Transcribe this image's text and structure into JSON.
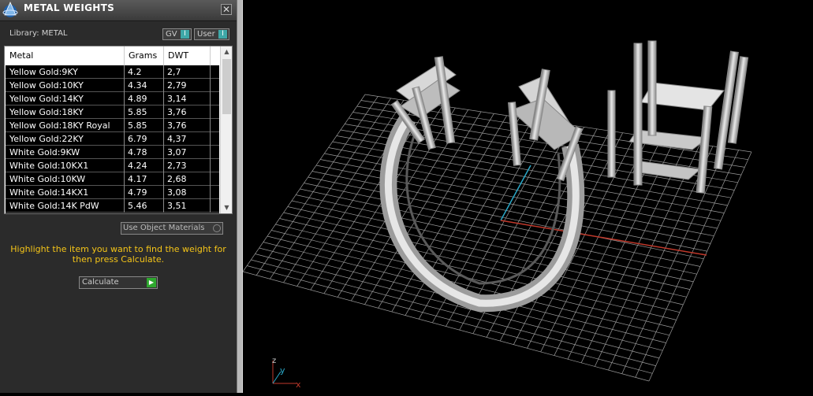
{
  "panel": {
    "title": "METAL WEIGHTS",
    "close_glyph": "✕",
    "library_label": "Library: METAL",
    "toggles": [
      {
        "label": "GV",
        "state": "I"
      },
      {
        "label": "User",
        "state": "I"
      }
    ],
    "table": {
      "columns": [
        "Metal",
        "Grams",
        "DWT"
      ],
      "rows": [
        {
          "metal": "Yellow Gold:9KY",
          "grams": "4.2",
          "dwt": "2,7"
        },
        {
          "metal": "Yellow Gold:10KY",
          "grams": "4.34",
          "dwt": "2,79"
        },
        {
          "metal": "Yellow Gold:14KY",
          "grams": "4.89",
          "dwt": "3,14"
        },
        {
          "metal": "Yellow Gold:18KY",
          "grams": "5.85",
          "dwt": "3,76"
        },
        {
          "metal": "Yellow Gold:18KY Royal",
          "grams": "5.85",
          "dwt": "3,76"
        },
        {
          "metal": "Yellow Gold:22KY",
          "grams": "6.79",
          "dwt": "4,37"
        },
        {
          "metal": "White Gold:9KW",
          "grams": "4.78",
          "dwt": "3,07"
        },
        {
          "metal": "White Gold:10KX1",
          "grams": "4.24",
          "dwt": "2,73"
        },
        {
          "metal": "White Gold:10KW",
          "grams": "4.17",
          "dwt": "2,68"
        },
        {
          "metal": "White Gold:14KX1",
          "grams": "4.79",
          "dwt": "3,08"
        },
        {
          "metal": "White Gold:14K PdW",
          "grams": "5.46",
          "dwt": "3,51"
        }
      ]
    },
    "use_object_materials": "Use Object Materials",
    "instruction": "Highlight the item you want to find the weight for then press Calculate.",
    "calculate_label": "Calculate"
  },
  "viewport": {
    "axis_labels": {
      "z": "z",
      "y": "y",
      "x": "x"
    },
    "colors": {
      "grid": "#9a9a9a",
      "x_axis": "#c0392b",
      "y_axis": "#2aa9c9",
      "metal": "#d6d6d6"
    }
  }
}
